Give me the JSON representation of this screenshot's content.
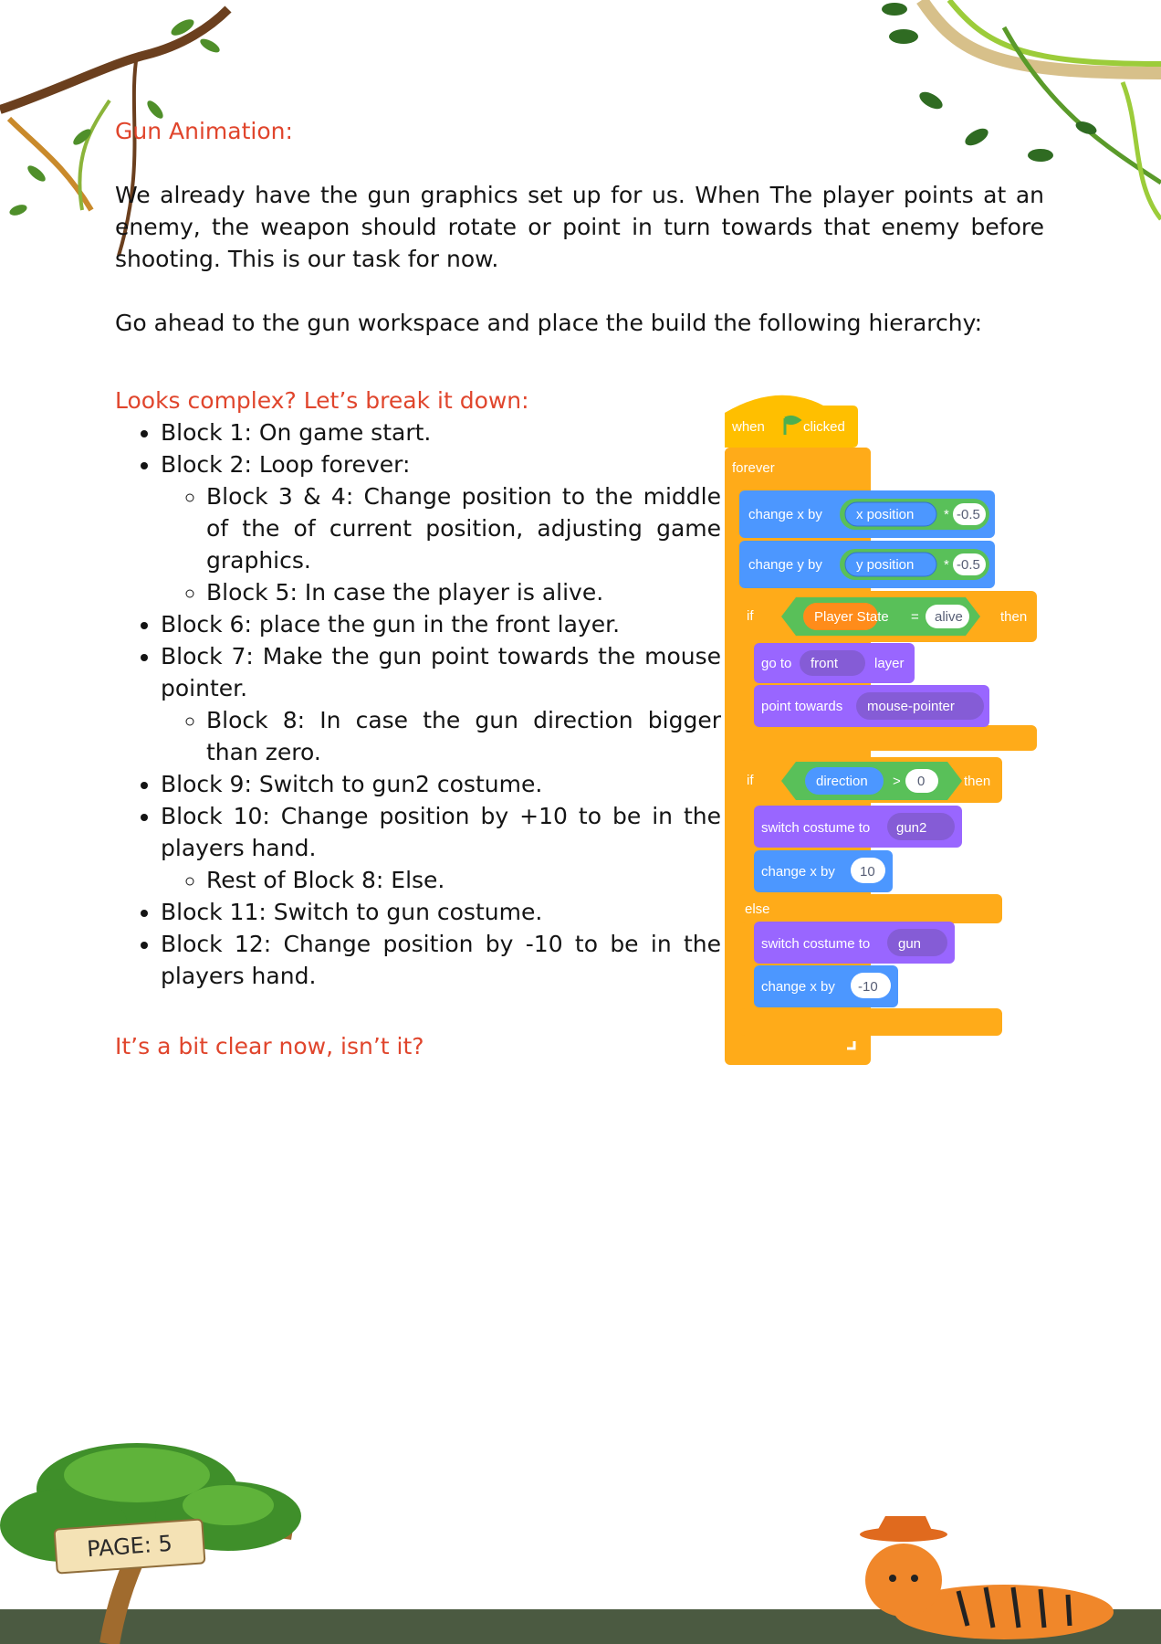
{
  "title": "Gun Animation:",
  "intro": "We already have the gun graphics set up for us. When The player points at an enemy, the weapon should rotate or point in turn towards that enemy before shooting. This is our task for now.",
  "instruction": "Go ahead to the gun workspace and place the build the following hierarchy:",
  "breakdown_heading": "Looks complex? Let’s break it down:",
  "items": [
    "Block 1: On game start.",
    "Block 2: Loop forever:",
    "Block 3 & 4: Change position to the middle of the of current position, adjusting game graphics.",
    "Block 5: In case the player is alive.",
    "Block 6: place the gun in the front layer.",
    "Block 7: Make the gun point towards the mouse pointer.",
    "Block 8: In case the gun direction bigger than zero.",
    "Block 9: Switch to gun2 costume.",
    "Block 10: Change position by +10 to be in the players hand.",
    "Rest of Block 8: Else.",
    "Block 11: Switch to gun costume.",
    "Block 12: Change position by -10 to be in the players hand."
  ],
  "closing": "It’s a bit clear now, isn’t it?",
  "page_label": "PAGE: 5",
  "scratch": {
    "when": "when",
    "clicked": "clicked",
    "forever": "forever",
    "change_x_by": "change x by",
    "change_y_by": "change y by",
    "x_position": "x position",
    "y_position": "y position",
    "times": "*",
    "neg_half": "-0.5",
    "if": "if",
    "then": "then",
    "player_state": "Player State",
    "equals": "=",
    "alive": "alive",
    "go_to": "go to",
    "front": "front",
    "layer": "layer",
    "point_towards": "point towards",
    "mouse_pointer": "mouse-pointer",
    "direction": "direction",
    "greater": ">",
    "zero": "0",
    "switch_costume_to": "switch costume to",
    "gun2": "gun2",
    "gun": "gun",
    "ten": "10",
    "neg_ten": "-10",
    "else": "else"
  },
  "colors": {
    "accent_red": "#e0452c",
    "events": "#ffbf00",
    "control": "#ffab19",
    "motion": "#4c97ff",
    "operators": "#59c059",
    "variables": "#ff8c1a",
    "looks": "#9966ff",
    "ground": "#4b5a41"
  }
}
